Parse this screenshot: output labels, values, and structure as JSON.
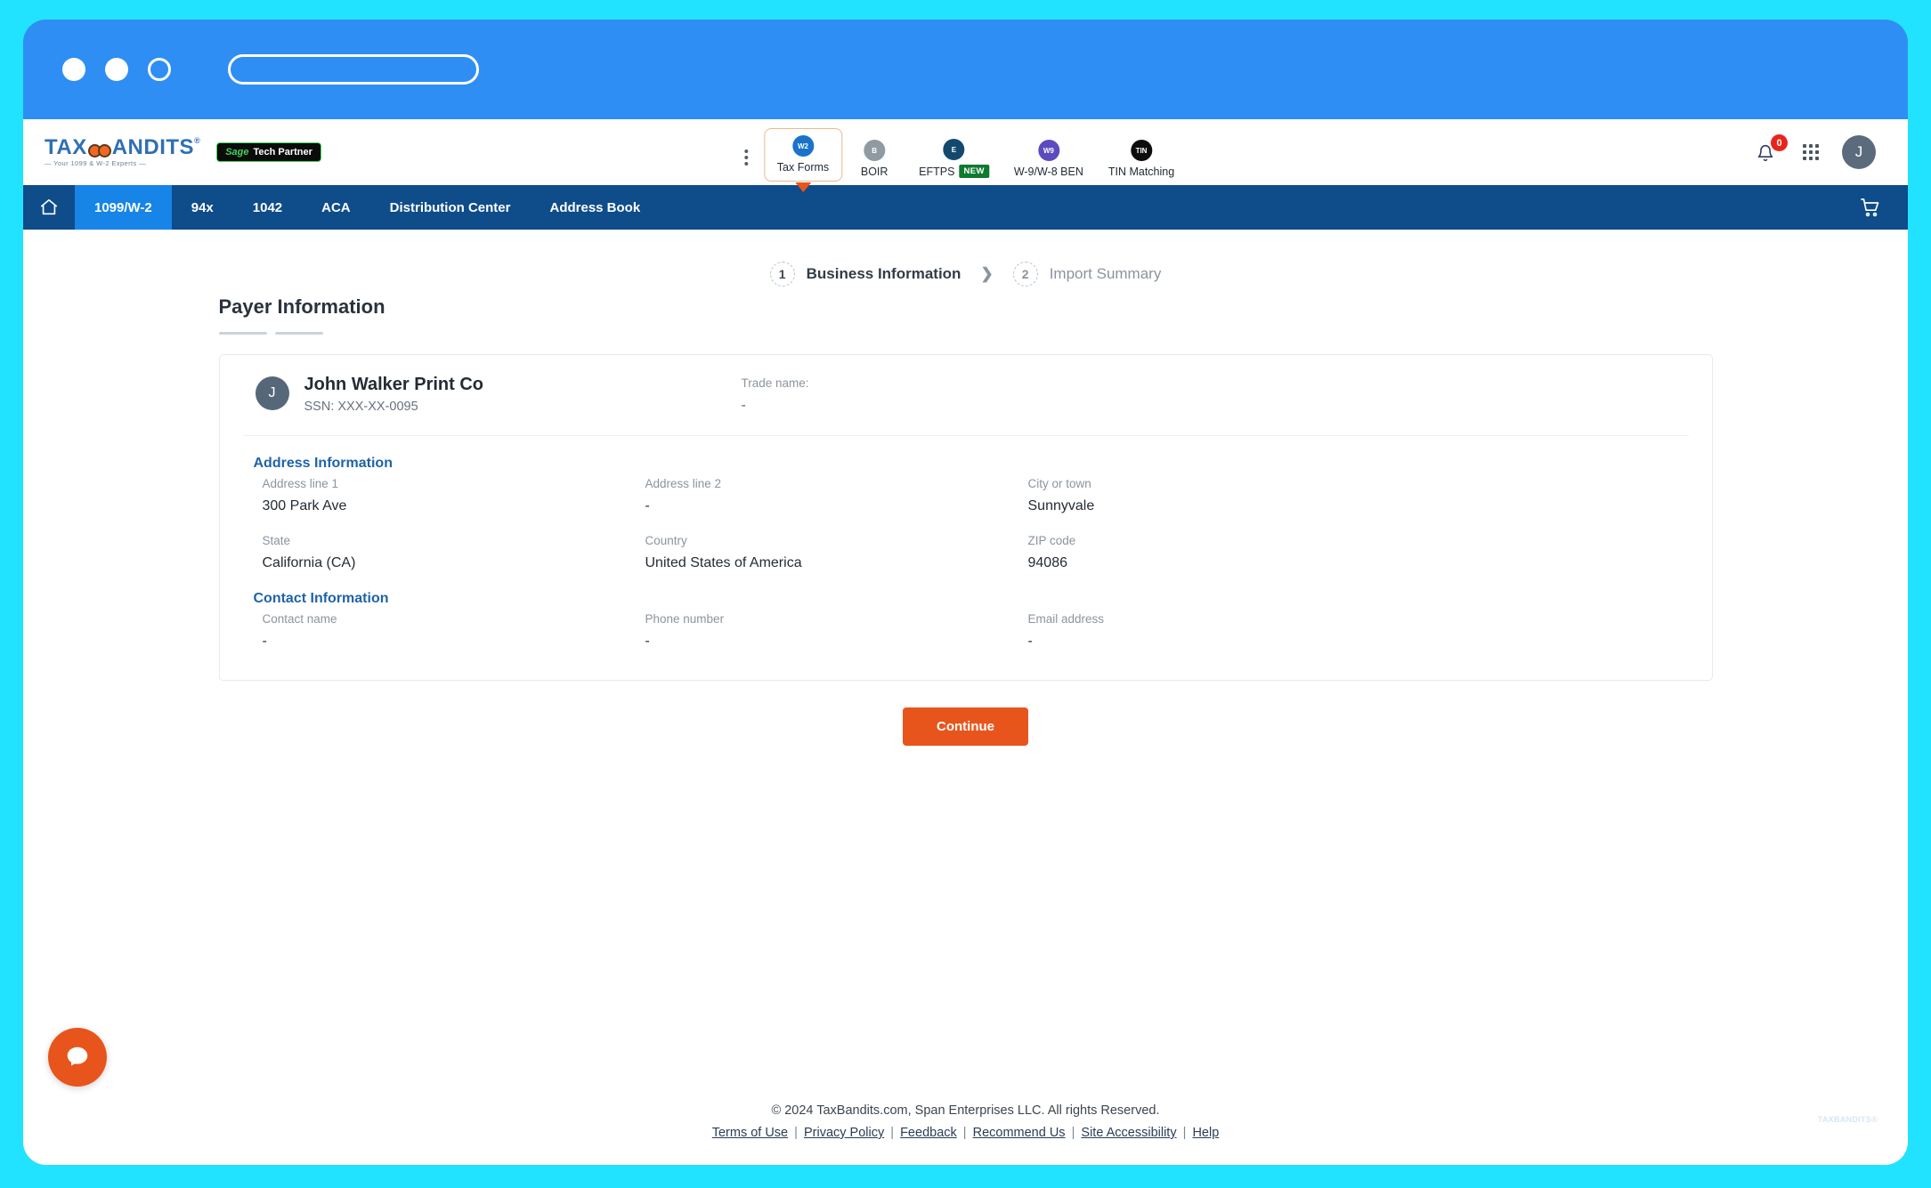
{
  "browser": {
    "dots": [
      "close-dot",
      "minimize-dot",
      "maximize-dot"
    ],
    "url_value": ""
  },
  "header": {
    "logo_text": "TAX",
    "logo_text2": "ANDITS",
    "logo_reg": "®",
    "logo_tagline": "— Your 1099 & W-2 Experts —",
    "partner_brand": "Sage",
    "partner_label": "Tech Partner",
    "kebab_label": "more-options",
    "nav_items": [
      {
        "label": "Tax Forms",
        "icon": "tax-forms-icon",
        "active": true,
        "badge": ""
      },
      {
        "label": "BOIR",
        "icon": "boir-icon",
        "active": false,
        "badge": ""
      },
      {
        "label": "EFTPS",
        "icon": "eftps-icon",
        "active": false,
        "badge": "NEW"
      },
      {
        "label": "W-9/W-8 BEN",
        "icon": "w9-icon",
        "active": false,
        "badge": ""
      },
      {
        "label": "TIN Matching",
        "icon": "tin-icon",
        "active": false,
        "badge": ""
      }
    ],
    "notification_count": "0",
    "avatar_initial": "J"
  },
  "navbar": {
    "home_icon": "home-icon",
    "tabs": [
      {
        "label": "1099/W-2",
        "active": true
      },
      {
        "label": "94x",
        "active": false
      },
      {
        "label": "1042",
        "active": false
      },
      {
        "label": "ACA",
        "active": false
      },
      {
        "label": "Distribution Center",
        "active": false
      },
      {
        "label": "Address Book",
        "active": false
      }
    ],
    "cart_icon": "cart-icon"
  },
  "stepper": {
    "steps": [
      {
        "number": "1",
        "label": "Business Information",
        "active": true
      },
      {
        "number": "2",
        "label": "Import Summary",
        "active": false
      }
    ],
    "separator": "❯"
  },
  "main": {
    "page_title": "Payer Information",
    "payer": {
      "avatar_initial": "J",
      "name": "John Walker Print Co",
      "ssn": "SSN: XXX-XX-0095",
      "trade_name_label": "Trade name:",
      "trade_name_value": "-"
    },
    "address_section": {
      "heading": "Address Information",
      "fields": [
        {
          "label": "Address line 1",
          "value": "300 Park Ave"
        },
        {
          "label": "Address line 2",
          "value": "-"
        },
        {
          "label": "City or town",
          "value": "Sunnyvale"
        },
        {
          "label": "State",
          "value": "California (CA)"
        },
        {
          "label": "Country",
          "value": "United States of America"
        },
        {
          "label": "ZIP code",
          "value": "94086"
        }
      ]
    },
    "contact_section": {
      "heading": "Contact Information",
      "fields": [
        {
          "label": "Contact name",
          "value": "-"
        },
        {
          "label": "Phone number",
          "value": "-"
        },
        {
          "label": "Email address",
          "value": "-"
        }
      ]
    },
    "continue_label": "Continue"
  },
  "footer": {
    "copyright": "© 2024 TaxBandits.com, Span Enterprises LLC. All rights Reserved.",
    "links": [
      "Terms of Use",
      "Privacy Policy",
      "Feedback",
      "Recommend Us",
      "Site Accessibility",
      "Help"
    ],
    "separator": "|",
    "watermark": "TAXBANDITS®"
  },
  "chat": {
    "icon": "chat-bubble-icon"
  },
  "colors": {
    "frame_neon": "#22e3ff",
    "browser_blue": "#2f8ef4",
    "nav_dark_blue": "#0f4c8a",
    "nav_active_blue": "#1784e8",
    "accent_orange": "#e8551c",
    "link_blue": "#1f63a8",
    "badge_red": "#e8241b",
    "badge_green": "#0d7a2e"
  }
}
